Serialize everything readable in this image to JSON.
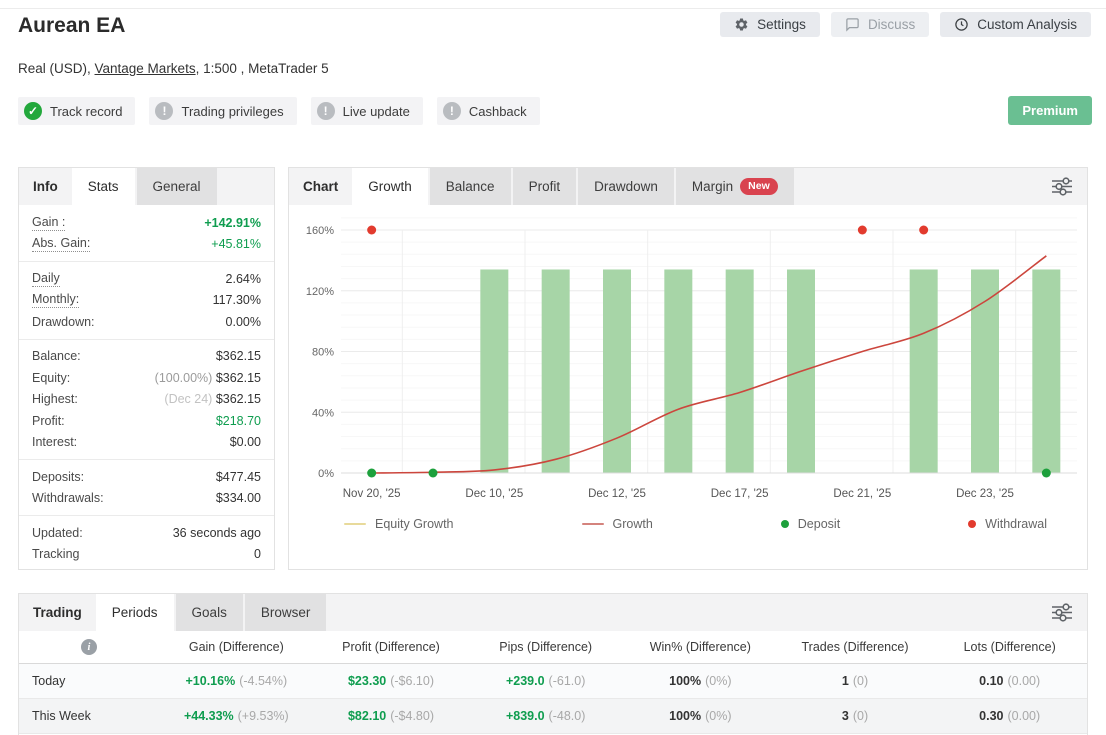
{
  "header": {
    "title": "Aurean EA",
    "subtitle": {
      "prefix": "Real (USD), ",
      "link": "Vantage Markets",
      "suffix": ", 1:500 , MetaTrader 5"
    },
    "buttons": [
      {
        "id": "settings",
        "label": "Settings",
        "icon": "gear",
        "disabled": false
      },
      {
        "id": "discuss",
        "label": "Discuss",
        "icon": "speech-bubble",
        "disabled": true
      },
      {
        "id": "custom-analysis",
        "label": "Custom Analysis",
        "icon": "clock",
        "disabled": false
      }
    ],
    "badges": [
      {
        "label": "Track record",
        "icon": "check",
        "color": "#23a83c"
      },
      {
        "label": "Trading privileges",
        "icon": "exclamation",
        "color": "#b9bcc0"
      },
      {
        "label": "Live update",
        "icon": "exclamation",
        "color": "#b9bcc0"
      },
      {
        "label": "Cashback",
        "icon": "exclamation",
        "color": "#b9bcc0"
      }
    ],
    "premium_label": "Premium",
    "premium_color": "#6abf92"
  },
  "info_panel": {
    "section_label": "Info",
    "tabs": [
      {
        "label": "Stats",
        "active": true
      },
      {
        "label": "General",
        "active": false
      }
    ],
    "groups": [
      {
        "rows": [
          {
            "label": "Gain :",
            "value": "+142.91%",
            "dotted": true,
            "value_style": "green bold"
          },
          {
            "label": "Abs. Gain:",
            "value": "+45.81%",
            "dotted": true,
            "value_style": "green"
          }
        ]
      },
      {
        "rows": [
          {
            "label": "Daily",
            "value": "2.64%",
            "dotted": true
          },
          {
            "label": "Monthly:",
            "value": "117.30%",
            "dotted": true
          },
          {
            "label": "Drawdown:",
            "value": "0.00%"
          }
        ]
      },
      {
        "rows": [
          {
            "label": "Balance:",
            "value": "$362.15"
          },
          {
            "label": "Equity:",
            "prefix": "(100.00%) ",
            "value": "$362.15"
          },
          {
            "label": "Highest:",
            "prefix": "(Dec 24) ",
            "prefix_light": true,
            "value": "$362.15"
          },
          {
            "label": "Profit:",
            "value": "$218.70",
            "value_style": "green"
          },
          {
            "label": "Interest:",
            "value": "$0.00"
          }
        ]
      },
      {
        "rows": [
          {
            "label": "Deposits:",
            "value": "$477.45"
          },
          {
            "label": "Withdrawals:",
            "value": "$334.00"
          }
        ]
      },
      {
        "rows": [
          {
            "label": "Updated:",
            "value": "36 seconds ago"
          },
          {
            "label": "Tracking",
            "value": "0"
          }
        ]
      }
    ]
  },
  "chart_panel": {
    "section_label": "Chart",
    "tabs": [
      {
        "label": "Growth",
        "active": true
      },
      {
        "label": "Balance"
      },
      {
        "label": "Profit"
      },
      {
        "label": "Drawdown"
      },
      {
        "label": "Margin",
        "badge": "New"
      }
    ]
  },
  "chart_data": {
    "type": "mixed-bar-line-scatter",
    "title": "Growth",
    "y_unit": "%",
    "y_ticks": [
      0,
      40,
      80,
      120,
      160
    ],
    "ylim": [
      0,
      172
    ],
    "x_slots": 12,
    "x_tick_labels": [
      {
        "slot": 0,
        "label": "Nov 20, '25"
      },
      {
        "slot": 2,
        "label": "Dec 10, '25"
      },
      {
        "slot": 4,
        "label": "Dec 12, '25"
      },
      {
        "slot": 6,
        "label": "Dec 17, '25"
      },
      {
        "slot": 8,
        "label": "Dec 21, '25"
      },
      {
        "slot": 10,
        "label": "Dec 23, '25"
      }
    ],
    "bars": {
      "slots": [
        2,
        3,
        4,
        5,
        6,
        7,
        9,
        10,
        11
      ],
      "value": 134,
      "color": "#a7d5a7"
    },
    "growth_line": {
      "name": "Growth",
      "color": "#cc463d",
      "values": [
        0,
        0.5,
        2,
        9,
        23,
        42,
        53,
        67,
        80,
        92,
        113,
        143
      ]
    },
    "deposits": {
      "name": "Deposit",
      "color": "#1da03c",
      "points": [
        {
          "slot": 0,
          "value": 0
        },
        {
          "slot": 1,
          "value": 0
        },
        {
          "slot": 11,
          "value": 0
        }
      ]
    },
    "withdrawals": {
      "name": "Withdrawal",
      "color": "#e23b2e",
      "points": [
        {
          "slot": 0,
          "value": 160
        },
        {
          "slot": 8,
          "value": 160
        },
        {
          "slot": 9,
          "value": 160
        }
      ]
    },
    "legend": [
      {
        "label": "Equity Growth",
        "swatch": "line",
        "color": "#e8da9b"
      },
      {
        "label": "Growth",
        "swatch": "line",
        "color": "#d4837d"
      },
      {
        "label": "Deposit",
        "swatch": "dot",
        "color": "#1da03c"
      },
      {
        "label": "Withdrawal",
        "swatch": "dot",
        "color": "#e23b2e"
      }
    ],
    "grid": true,
    "legend_position": "bottom"
  },
  "trading_panel": {
    "section_label": "Trading",
    "tabs": [
      {
        "label": "Periods",
        "active": true
      },
      {
        "label": "Goals"
      },
      {
        "label": "Browser"
      }
    ],
    "columns": [
      "Gain (Difference)",
      "Profit (Difference)",
      "Pips (Difference)",
      "Win% (Difference)",
      "Trades (Difference)",
      "Lots (Difference)"
    ],
    "rows": [
      {
        "label": "Today",
        "cells": [
          {
            "main": "+10.16%",
            "diff": "(-4.54%)",
            "green": true
          },
          {
            "main": "$23.30",
            "diff": "(-$6.10)",
            "green": true
          },
          {
            "main": "+239.0",
            "diff": "(-61.0)",
            "green": true
          },
          {
            "main": "100%",
            "diff": "(0%)"
          },
          {
            "main": "1",
            "diff": "(0)"
          },
          {
            "main": "0.10",
            "diff": "(0.00)"
          }
        ]
      },
      {
        "label": "This Week",
        "cells": [
          {
            "main": "+44.33%",
            "diff": "(+9.53%)",
            "green": true
          },
          {
            "main": "$82.10",
            "diff": "(-$4.80)",
            "green": true
          },
          {
            "main": "+839.0",
            "diff": "(-48.0)",
            "green": true
          },
          {
            "main": "100%",
            "diff": "(0%)"
          },
          {
            "main": "3",
            "diff": "(0)"
          },
          {
            "main": "0.30",
            "diff": "(0.00)"
          }
        ]
      }
    ]
  }
}
